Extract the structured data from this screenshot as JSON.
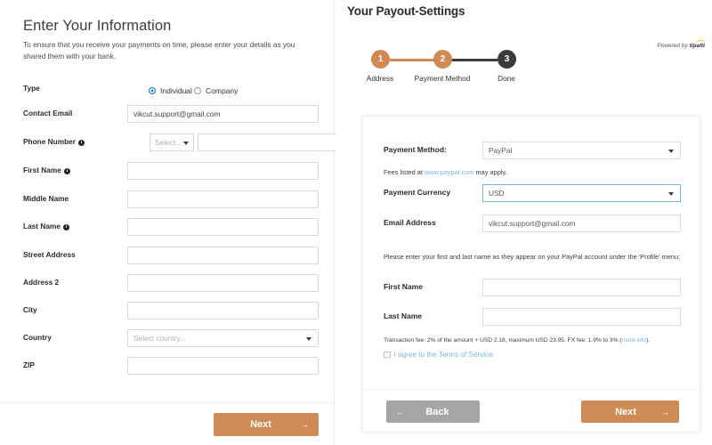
{
  "left": {
    "title": "Enter Your Information",
    "subtitle": "To ensure that you receive your payments on time, please enter your details as you shared them with your bank.",
    "fields": [
      {
        "label": "Type",
        "kind": "radio"
      },
      {
        "label": "Contact Email",
        "kind": "text",
        "value": "vikcut.support@gmail.com",
        "placeholder": ""
      },
      {
        "label": "Phone Number",
        "kind": "phone",
        "info": true,
        "code_placeholder": "Select...",
        "value": ""
      },
      {
        "label": "First Name",
        "kind": "text",
        "info": true,
        "value": "",
        "placeholder": ""
      },
      {
        "label": "Middle Name",
        "kind": "text",
        "value": "",
        "placeholder": ""
      },
      {
        "label": "Last Name",
        "kind": "text",
        "info": true,
        "value": "",
        "placeholder": ""
      },
      {
        "label": "Street Address",
        "kind": "text",
        "value": "",
        "placeholder": ""
      },
      {
        "label": "Address 2",
        "kind": "text",
        "value": "",
        "placeholder": ""
      },
      {
        "label": "City",
        "kind": "text",
        "value": "",
        "placeholder": ""
      },
      {
        "label": "Country",
        "kind": "select",
        "value": "",
        "placeholder": "Select country..."
      },
      {
        "label": "ZIP",
        "kind": "text",
        "value": "",
        "placeholder": ""
      }
    ],
    "radios": [
      {
        "label": "Individual",
        "selected": true
      },
      {
        "label": "Company",
        "selected": false
      }
    ],
    "next_label": "Next",
    "next_arrow": "→",
    "info_glyph": "i"
  },
  "right": {
    "title": "Your Payout-Settings",
    "powered_by": "Powered by",
    "brand": "tipalti",
    "steps": [
      {
        "number": "1",
        "label": "Address",
        "state": "active"
      },
      {
        "number": "2",
        "label": "Payment Method",
        "state": "active"
      },
      {
        "number": "3",
        "label": "Done",
        "state": "done"
      }
    ],
    "card": {
      "payment_method_label": "Payment Method:",
      "payment_method_value": "PayPal",
      "fees_note_pre": "Fees listed at ",
      "fees_note_link": "www.paypal.com",
      "fees_note_post": " may apply.",
      "currency_label": "Payment Currency",
      "currency_value": "USD",
      "email_label": "Email Address",
      "email_value": "vikcut.support@gmail.com",
      "name_note": "Please enter your first and last name as they appear on your PayPal account under the 'Profile' menu:",
      "first_name_label": "First Name",
      "first_name_value": "",
      "last_name_label": "Last Name",
      "last_name_value": "",
      "fee_note_pre": "Transaction fee: 2% of the amount + USD 2.18, maximum USD 23.95. FX fee: 1.9% to 3% (",
      "fee_note_link": "more info",
      "fee_note_post": ").",
      "tos_label": "I agree to the Terms of Service",
      "tos_checked": false,
      "back_label": "Back",
      "back_arrow": "←",
      "next_label": "Next",
      "next_arrow": "→"
    }
  },
  "colors": {
    "accent": "#cf8b55",
    "step_done": "#3b3b3b",
    "link": "#7ab6dd",
    "radio_on": "#1878d0",
    "back_button": "#a6a6a6"
  }
}
